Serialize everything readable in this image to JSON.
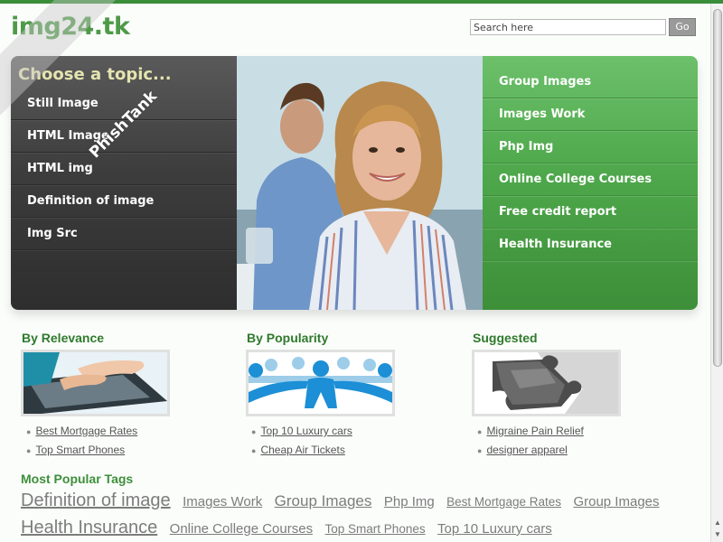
{
  "site": {
    "logo": "img24.tk"
  },
  "search": {
    "placeholder": "Search here",
    "button": "Go"
  },
  "banner": {
    "heading": "Choose a topic...",
    "topics": [
      "Still Image",
      "HTML Image",
      "HTML img",
      "Definition of image",
      "Img Src"
    ],
    "links": [
      "Group Images",
      "Images Work",
      "Php Img",
      "Online College Courses",
      "Free credit report",
      "Health Insurance"
    ]
  },
  "watermark": {
    "text": "PhishTank"
  },
  "sections": [
    {
      "title": "By Relevance",
      "icon": "laptop-typing-image",
      "links": [
        "Best Mortgage Rates",
        "Top Smart Phones"
      ]
    },
    {
      "title": "By Popularity",
      "icon": "people-chain-image",
      "links": [
        "Top 10 Luxury cars",
        "Cheap Air Tickets"
      ]
    },
    {
      "title": "Suggested",
      "icon": "puzzle-pieces-image",
      "links": [
        "Migraine Pain Relief",
        "designer apparel"
      ]
    }
  ],
  "popular_tags": {
    "title": "Most Popular Tags",
    "tags": [
      {
        "text": "Definition of image",
        "size": "xl"
      },
      {
        "text": "Images Work",
        "size": "m"
      },
      {
        "text": "Group Images",
        "size": "l"
      },
      {
        "text": "Php Img",
        "size": "m"
      },
      {
        "text": "Best Mortgage Rates",
        "size": "s"
      },
      {
        "text": "Group Images",
        "size": "m"
      },
      {
        "text": "Health Insurance",
        "size": "xl"
      },
      {
        "text": "Online College Courses",
        "size": "m"
      },
      {
        "text": "Top Smart Phones",
        "size": "s"
      },
      {
        "text": "Top 10 Luxury cars",
        "size": "m"
      }
    ]
  },
  "colors": {
    "accent_green": "#4e9a48",
    "dark_panel": "#3d3d3d",
    "top_bar": "#3a8e3a"
  }
}
